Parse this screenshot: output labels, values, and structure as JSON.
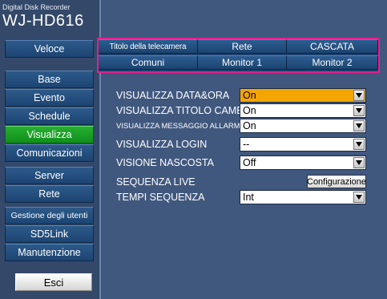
{
  "brand": {
    "subtitle": "Digital Disk Recorder",
    "model": "WJ-HD616"
  },
  "sidebar": {
    "items": [
      {
        "label": "Veloce"
      },
      {
        "label": "Base"
      },
      {
        "label": "Evento"
      },
      {
        "label": "Schedule"
      },
      {
        "label": "Visualizza",
        "active": true
      },
      {
        "label": "Comunicazioni"
      },
      {
        "label": "Server"
      },
      {
        "label": "Rete"
      },
      {
        "label": "Gestione degli utenti"
      },
      {
        "label": "SD5Link"
      },
      {
        "label": "Manutenzione"
      }
    ],
    "exit_label": "Esci"
  },
  "tabs": {
    "row1": [
      {
        "label": "Titolo della telecamera"
      },
      {
        "label": "Rete"
      },
      {
        "label": "CASCATA"
      }
    ],
    "row2": [
      {
        "label": "Comuni"
      },
      {
        "label": "Monitor 1"
      },
      {
        "label": "Monitor 2"
      }
    ],
    "highlight_color": "#e61e8c"
  },
  "settings": {
    "rows": [
      {
        "label": "VISUALIZZA DATA&ORA",
        "value": "On",
        "highlighted": true
      },
      {
        "label": "VISUALIZZA TITOLO CAMERA",
        "value": "On"
      },
      {
        "label": "VISUALIZZA MESSAGGIO ALLARME",
        "value": "On"
      },
      {
        "label": "VISUALIZZA LOGIN",
        "value": "--"
      },
      {
        "label": "VISIONE NASCOSTA",
        "value": "Off"
      },
      {
        "label": "SEQUENZA LIVE",
        "button": "Configurazione"
      },
      {
        "label": "TEMPI SEQUENZA",
        "value": "Int"
      }
    ]
  },
  "colors": {
    "selected_value_bg": "#f5a500",
    "active_nav": "#14a023"
  }
}
